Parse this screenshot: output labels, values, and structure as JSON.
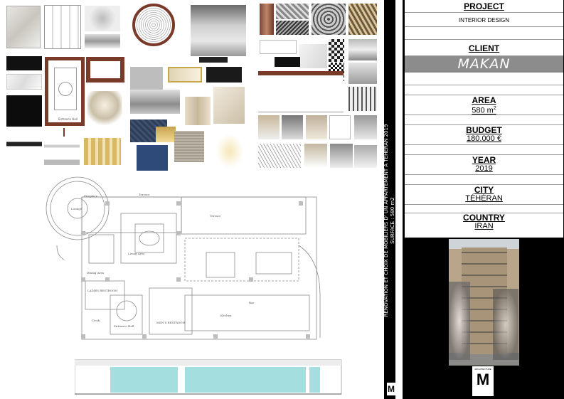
{
  "info": {
    "project_label": "PROJECT",
    "project_value": "INTERIOR DESIGN",
    "client_label": "CLIENT",
    "client_value": "MAKAN",
    "area_label": "AREA",
    "area_value": "580 m",
    "area_unit_sup": "2",
    "budget_label": "BUDGET",
    "budget_value": "180.000 €",
    "year_label": "YEAR",
    "year_value": "2019",
    "city_label": "CITY",
    "city_value": "TÉHÉRAN",
    "country_label": "COUNTRY",
    "country_value": "IRAN"
  },
  "vertical_caption": {
    "line1": "RENOVATION ET CHOIX DE MOBILIERS D' UN APPARTEMENT A TEHERAN 2019",
    "line2": "SURFACE : 580 m2"
  },
  "logo": {
    "text_top": "ARCHITECTURE",
    "letter": "M"
  },
  "plan_labels": {
    "fireplace": "Fireplace",
    "lounge": "Lounge",
    "terrace_top": "Terrace",
    "terrace_right": "Terrace",
    "living": "Living Area",
    "dining": "Dining Area",
    "ladies": "LADIES RESTROOM",
    "entrance": "Entrance Hall",
    "mens": "MEN'S RESTROOM",
    "bar": "Bar",
    "kitchen": "Kitchen",
    "desk": "Desk",
    "entrance_hall_thumb": "Entrance Hall"
  },
  "colors": {
    "accent_brown": "#7a3a2a",
    "glass_cyan": "#8fd6d6",
    "panel_black": "#000000",
    "client_grey": "#8c8c8c"
  }
}
